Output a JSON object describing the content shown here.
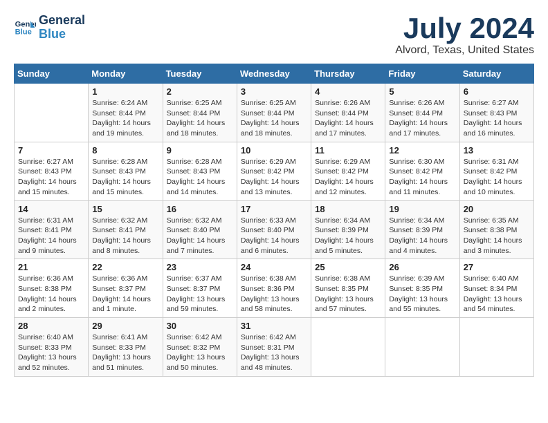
{
  "logo": {
    "line1": "General",
    "line2": "Blue"
  },
  "title": "July 2024",
  "location": "Alvord, Texas, United States",
  "days_header": [
    "Sunday",
    "Monday",
    "Tuesday",
    "Wednesday",
    "Thursday",
    "Friday",
    "Saturday"
  ],
  "weeks": [
    [
      {
        "day": "",
        "info": ""
      },
      {
        "day": "1",
        "info": "Sunrise: 6:24 AM\nSunset: 8:44 PM\nDaylight: 14 hours\nand 19 minutes."
      },
      {
        "day": "2",
        "info": "Sunrise: 6:25 AM\nSunset: 8:44 PM\nDaylight: 14 hours\nand 18 minutes."
      },
      {
        "day": "3",
        "info": "Sunrise: 6:25 AM\nSunset: 8:44 PM\nDaylight: 14 hours\nand 18 minutes."
      },
      {
        "day": "4",
        "info": "Sunrise: 6:26 AM\nSunset: 8:44 PM\nDaylight: 14 hours\nand 17 minutes."
      },
      {
        "day": "5",
        "info": "Sunrise: 6:26 AM\nSunset: 8:44 PM\nDaylight: 14 hours\nand 17 minutes."
      },
      {
        "day": "6",
        "info": "Sunrise: 6:27 AM\nSunset: 8:43 PM\nDaylight: 14 hours\nand 16 minutes."
      }
    ],
    [
      {
        "day": "7",
        "info": "Sunrise: 6:27 AM\nSunset: 8:43 PM\nDaylight: 14 hours\nand 15 minutes."
      },
      {
        "day": "8",
        "info": "Sunrise: 6:28 AM\nSunset: 8:43 PM\nDaylight: 14 hours\nand 15 minutes."
      },
      {
        "day": "9",
        "info": "Sunrise: 6:28 AM\nSunset: 8:43 PM\nDaylight: 14 hours\nand 14 minutes."
      },
      {
        "day": "10",
        "info": "Sunrise: 6:29 AM\nSunset: 8:42 PM\nDaylight: 14 hours\nand 13 minutes."
      },
      {
        "day": "11",
        "info": "Sunrise: 6:29 AM\nSunset: 8:42 PM\nDaylight: 14 hours\nand 12 minutes."
      },
      {
        "day": "12",
        "info": "Sunrise: 6:30 AM\nSunset: 8:42 PM\nDaylight: 14 hours\nand 11 minutes."
      },
      {
        "day": "13",
        "info": "Sunrise: 6:31 AM\nSunset: 8:42 PM\nDaylight: 14 hours\nand 10 minutes."
      }
    ],
    [
      {
        "day": "14",
        "info": "Sunrise: 6:31 AM\nSunset: 8:41 PM\nDaylight: 14 hours\nand 9 minutes."
      },
      {
        "day": "15",
        "info": "Sunrise: 6:32 AM\nSunset: 8:41 PM\nDaylight: 14 hours\nand 8 minutes."
      },
      {
        "day": "16",
        "info": "Sunrise: 6:32 AM\nSunset: 8:40 PM\nDaylight: 14 hours\nand 7 minutes."
      },
      {
        "day": "17",
        "info": "Sunrise: 6:33 AM\nSunset: 8:40 PM\nDaylight: 14 hours\nand 6 minutes."
      },
      {
        "day": "18",
        "info": "Sunrise: 6:34 AM\nSunset: 8:39 PM\nDaylight: 14 hours\nand 5 minutes."
      },
      {
        "day": "19",
        "info": "Sunrise: 6:34 AM\nSunset: 8:39 PM\nDaylight: 14 hours\nand 4 minutes."
      },
      {
        "day": "20",
        "info": "Sunrise: 6:35 AM\nSunset: 8:38 PM\nDaylight: 14 hours\nand 3 minutes."
      }
    ],
    [
      {
        "day": "21",
        "info": "Sunrise: 6:36 AM\nSunset: 8:38 PM\nDaylight: 14 hours\nand 2 minutes."
      },
      {
        "day": "22",
        "info": "Sunrise: 6:36 AM\nSunset: 8:37 PM\nDaylight: 14 hours\nand 1 minute."
      },
      {
        "day": "23",
        "info": "Sunrise: 6:37 AM\nSunset: 8:37 PM\nDaylight: 13 hours\nand 59 minutes."
      },
      {
        "day": "24",
        "info": "Sunrise: 6:38 AM\nSunset: 8:36 PM\nDaylight: 13 hours\nand 58 minutes."
      },
      {
        "day": "25",
        "info": "Sunrise: 6:38 AM\nSunset: 8:35 PM\nDaylight: 13 hours\nand 57 minutes."
      },
      {
        "day": "26",
        "info": "Sunrise: 6:39 AM\nSunset: 8:35 PM\nDaylight: 13 hours\nand 55 minutes."
      },
      {
        "day": "27",
        "info": "Sunrise: 6:40 AM\nSunset: 8:34 PM\nDaylight: 13 hours\nand 54 minutes."
      }
    ],
    [
      {
        "day": "28",
        "info": "Sunrise: 6:40 AM\nSunset: 8:33 PM\nDaylight: 13 hours\nand 52 minutes."
      },
      {
        "day": "29",
        "info": "Sunrise: 6:41 AM\nSunset: 8:33 PM\nDaylight: 13 hours\nand 51 minutes."
      },
      {
        "day": "30",
        "info": "Sunrise: 6:42 AM\nSunset: 8:32 PM\nDaylight: 13 hours\nand 50 minutes."
      },
      {
        "day": "31",
        "info": "Sunrise: 6:42 AM\nSunset: 8:31 PM\nDaylight: 13 hours\nand 48 minutes."
      },
      {
        "day": "",
        "info": ""
      },
      {
        "day": "",
        "info": ""
      },
      {
        "day": "",
        "info": ""
      }
    ]
  ]
}
